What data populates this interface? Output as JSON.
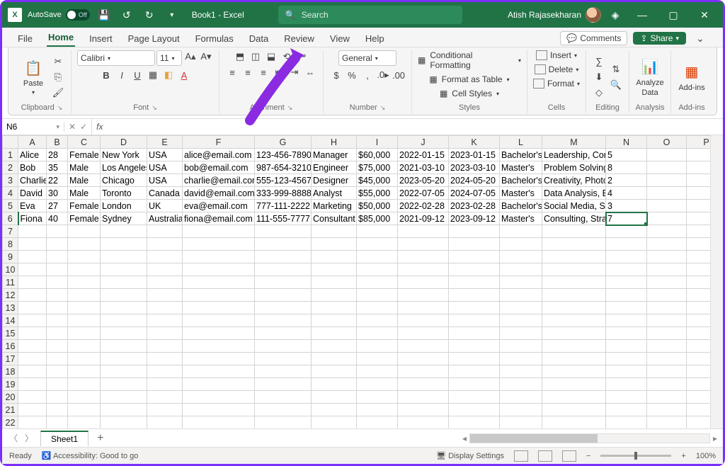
{
  "title": {
    "autosave": "AutoSave",
    "autosave_state": "Off",
    "doc": "Book1 - Excel",
    "search_placeholder": "Search",
    "user": "Atish Rajasekharan"
  },
  "tabs": {
    "file": "File",
    "home": "Home",
    "insert": "Insert",
    "pagelayout": "Page Layout",
    "formulas": "Formulas",
    "data": "Data",
    "review": "Review",
    "view": "View",
    "help": "Help",
    "comments": "Comments",
    "share": "Share"
  },
  "ribbon": {
    "clipboard": {
      "paste": "Paste",
      "label": "Clipboard"
    },
    "font": {
      "name": "Calibri",
      "size": "11",
      "label": "Font"
    },
    "alignment": {
      "label": "Alignment"
    },
    "number": {
      "format": "General",
      "label": "Number"
    },
    "styles": {
      "cond": "Conditional Formatting",
      "table": "Format as Table",
      "cell": "Cell Styles",
      "label": "Styles"
    },
    "cells": {
      "insert": "Insert",
      "delete": "Delete",
      "format": "Format",
      "label": "Cells"
    },
    "editing": {
      "label": "Editing"
    },
    "analysis": {
      "analyze": "Analyze",
      "data": "Data",
      "label": "Analysis"
    },
    "addins": {
      "addins": "Add-ins",
      "label": "Add-ins"
    }
  },
  "formula_bar": {
    "cell_ref": "N6"
  },
  "columns": [
    "A",
    "B",
    "C",
    "D",
    "E",
    "F",
    "G",
    "H",
    "I",
    "J",
    "K",
    "L",
    "M",
    "N",
    "O",
    "P"
  ],
  "rows": [
    {
      "A": "Alice",
      "B": "28",
      "C": "Female",
      "D": "New York",
      "E": "USA",
      "F": "alice@email.com",
      "G": "123-456-7890",
      "H": "Manager",
      "I": "$60,000",
      "J": "2022-01-15",
      "K": "2023-01-15",
      "L": "Bachelor's",
      "M": "Leadership, Communication",
      "N": "5"
    },
    {
      "A": "Bob",
      "B": "35",
      "C": "Male",
      "D": "Los Angeles",
      "E": "USA",
      "F": "bob@email.com",
      "G": "987-654-3210",
      "H": "Engineer",
      "I": "$75,000",
      "J": "2021-03-10",
      "K": "2023-03-10",
      "L": "Master's",
      "M": "Problem Solving, Coding",
      "N": "8"
    },
    {
      "A": "Charlie",
      "B": "22",
      "C": "Male",
      "D": "Chicago",
      "E": "USA",
      "F": "charlie@email.com",
      "G": "555-123-4567",
      "H": "Designer",
      "I": "$45,000",
      "J": "2023-05-20",
      "K": "2024-05-20",
      "L": "Bachelor's",
      "M": "Creativity, Photoshop",
      "N": "2"
    },
    {
      "A": "David",
      "B": "30",
      "C": "Male",
      "D": "Toronto",
      "E": "Canada",
      "F": "david@email.com",
      "G": "333-999-8888",
      "H": "Analyst",
      "I": "$55,000",
      "J": "2022-07-05",
      "K": "2024-07-05",
      "L": "Master's",
      "M": "Data Analysis, Excel",
      "N": "4"
    },
    {
      "A": "Eva",
      "B": "27",
      "C": "Female",
      "D": "London",
      "E": "UK",
      "F": "eva@email.com",
      "G": "777-111-2222",
      "H": "Marketing",
      "I": "$50,000",
      "J": "2022-02-28",
      "K": "2023-02-28",
      "L": "Bachelor's",
      "M": "Social Media, SEO",
      "N": "3"
    },
    {
      "A": "Fiona",
      "B": "40",
      "C": "Female",
      "D": "Sydney",
      "E": "Australia",
      "F": "fiona@email.com",
      "G": "111-555-7777",
      "H": "Consultant",
      "I": "$85,000",
      "J": "2021-09-12",
      "K": "2023-09-12",
      "L": "Master's",
      "M": "Consulting, Strategy",
      "N": "7"
    }
  ],
  "total_visible_rows": 22,
  "sheet": {
    "name": "Sheet1"
  },
  "status": {
    "ready": "Ready",
    "access": "Accessibility: Good to go",
    "display": "Display Settings",
    "zoom": "100%"
  }
}
